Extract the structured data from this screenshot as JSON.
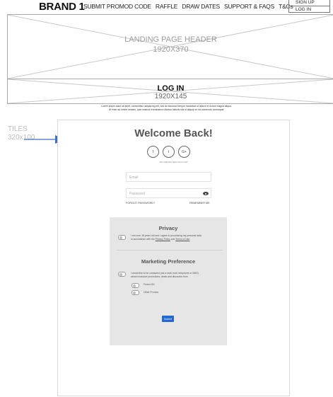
{
  "nav": {
    "brand": "BRAND 1",
    "links": [
      "SUBMIT PROMOD CODE",
      "RAFFLE",
      "DRAW DATES",
      "SUPPORT & FAQS",
      "T&Cs"
    ],
    "sign_up": "SIGN UP",
    "log_in": "LOG  IN"
  },
  "hero": {
    "title": "LANDING PAGE HEADER",
    "size": "1920X370"
  },
  "login_bar": {
    "title": "LOG IN",
    "size": "1920X145"
  },
  "intro_text": {
    "line1": "Lorem ipsum dolor sit amet, consectetur adipiscing elit, sed do eiusmod tempor incididunt ut labore et dolore magna aliqua.",
    "line2": "Ut enim ad minim veniam, quis nostrud exercitation ullamco laboris nisi ut aliquip ex ea commodo consequat."
  },
  "annotation": {
    "label": "TILES",
    "size": "320x100"
  },
  "form": {
    "heading": "Welcome Back!",
    "social_icons": [
      "f",
      "t",
      "G+"
    ],
    "or_text": "OR CREATE NEW ACCOUNT",
    "email_placeholder": "Email",
    "password_placeholder": "Password",
    "forgot": "FORGOT PASSWORD?",
    "remember": "REMEMBER ME",
    "privacy_heading": "Privacy",
    "privacy_text_1": "I am over 18 years old and I agree to processing my personal data",
    "privacy_text_2a": "in accordance with the ",
    "privacy_link": "Privacy Policy",
    "privacy_text_2b": " and ",
    "terms_link": "Terms of Use",
    "marketing_heading": "Marketing Preference",
    "marketing_text_1": "I would like to be contacted (via e-mail, mail, telephone or SMS)",
    "marketing_text_2": "about exclusive promotions, deals and discounts from",
    "option_1": "Promo DD",
    "option_2": "Other Promos",
    "submit": "Submit"
  }
}
